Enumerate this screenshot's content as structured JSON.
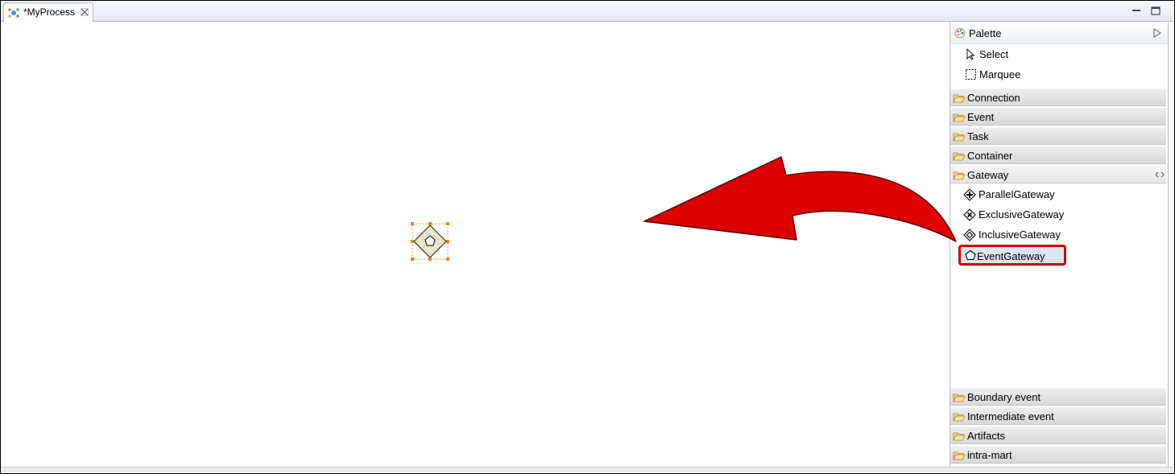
{
  "editor": {
    "tab_title": "*MyProcess"
  },
  "palette": {
    "title": "Palette",
    "tools": [
      {
        "label": "Select",
        "icon": "arrow-pointer-icon"
      },
      {
        "label": "Marquee",
        "icon": "marquee-icon"
      }
    ],
    "drawers_top": [
      {
        "label": "Connection"
      },
      {
        "label": "Event"
      },
      {
        "label": "Task"
      },
      {
        "label": "Container"
      }
    ],
    "gateway_drawer": {
      "label": "Gateway",
      "items": [
        {
          "label": "ParallelGateway",
          "icon": "parallel-gateway-icon"
        },
        {
          "label": "ExclusiveGateway",
          "icon": "exclusive-gateway-icon"
        },
        {
          "label": "InclusiveGateway",
          "icon": "inclusive-gateway-icon"
        },
        {
          "label": "EventGateway",
          "icon": "event-gateway-icon",
          "selected": true
        }
      ]
    },
    "drawers_bottom": [
      {
        "label": "Boundary event"
      },
      {
        "label": "Intermediate event"
      },
      {
        "label": "Artifacts"
      },
      {
        "label": "intra-mart"
      }
    ]
  },
  "colors": {
    "highlight_border": "#d10000",
    "arrow_fill": "#dd0000",
    "selection_handle": "#f08000",
    "gateway_fill": "#e8e4c8"
  }
}
